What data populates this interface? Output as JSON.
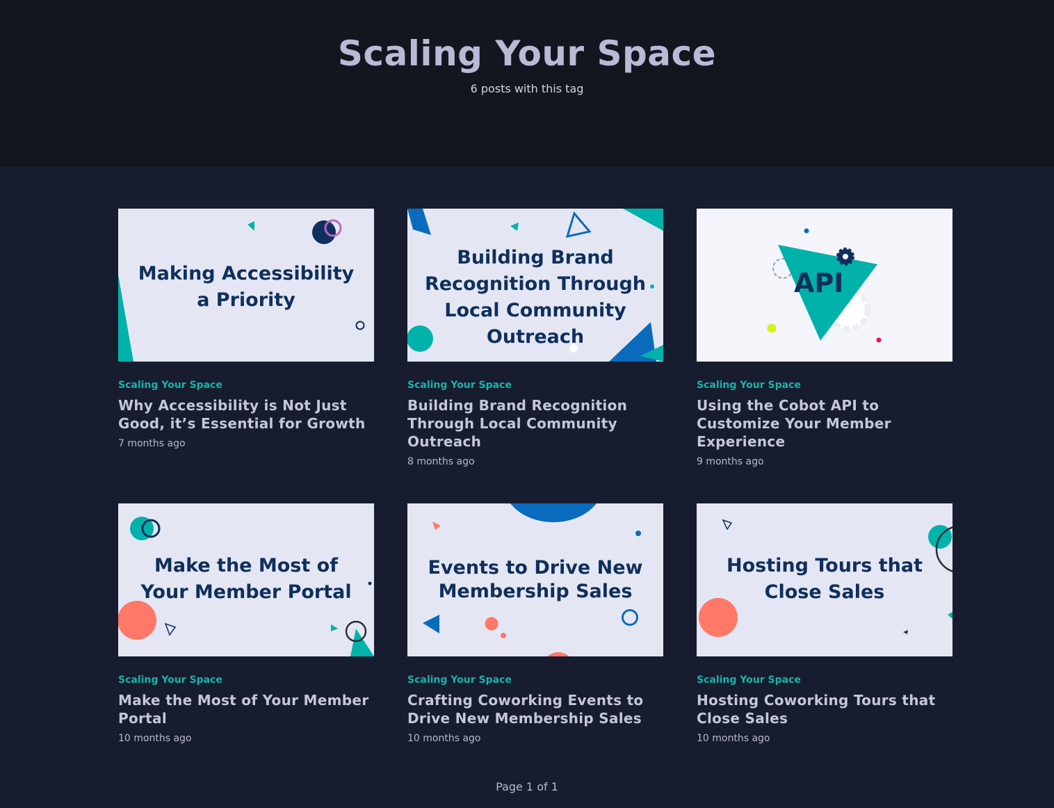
{
  "header": {
    "title": "Scaling Your Space",
    "subtitle": "6 posts with this tag"
  },
  "posts": [
    {
      "image_title": "Making Accessibility a Priority",
      "tag": "Scaling Your Space",
      "title": "Why Accessibility is Not Just Good, it’s Essential for Growth",
      "date": "7 months ago"
    },
    {
      "image_title": "Building Brand Recognition Through Local Community Outreach",
      "tag": "Scaling Your Space",
      "title": "Building Brand Recognition Through Local Community Outreach",
      "date": "8 months ago"
    },
    {
      "image_title": "API",
      "tag": "Scaling Your Space",
      "title": "Using the Cobot API to Customize Your Member Experience",
      "date": "9 months ago"
    },
    {
      "image_title": "Make the Most of Your Member Portal",
      "tag": "Scaling Your Space",
      "title": "Make the Most of Your Member Portal",
      "date": "10 months ago"
    },
    {
      "image_title": "Events to Drive New Membership Sales",
      "tag": "Scaling Your Space",
      "title": "Crafting Coworking Events to Drive New Membership Sales",
      "date": "10 months ago"
    },
    {
      "image_title": "Hosting Tours that Close Sales",
      "tag": "Scaling Your Space",
      "title": "Hosting Coworking Tours that Close Sales",
      "date": "10 months ago"
    }
  ],
  "pagination": {
    "label": "Page 1 of 1"
  },
  "colors": {
    "hero_bg": "#12171f",
    "page_bg": "#171c2f",
    "tag": "#1ab3a6",
    "teal": "#00b2a9",
    "navy": "#0f2f5c",
    "blue": "#0a6bbd",
    "coral": "#ff7868"
  }
}
